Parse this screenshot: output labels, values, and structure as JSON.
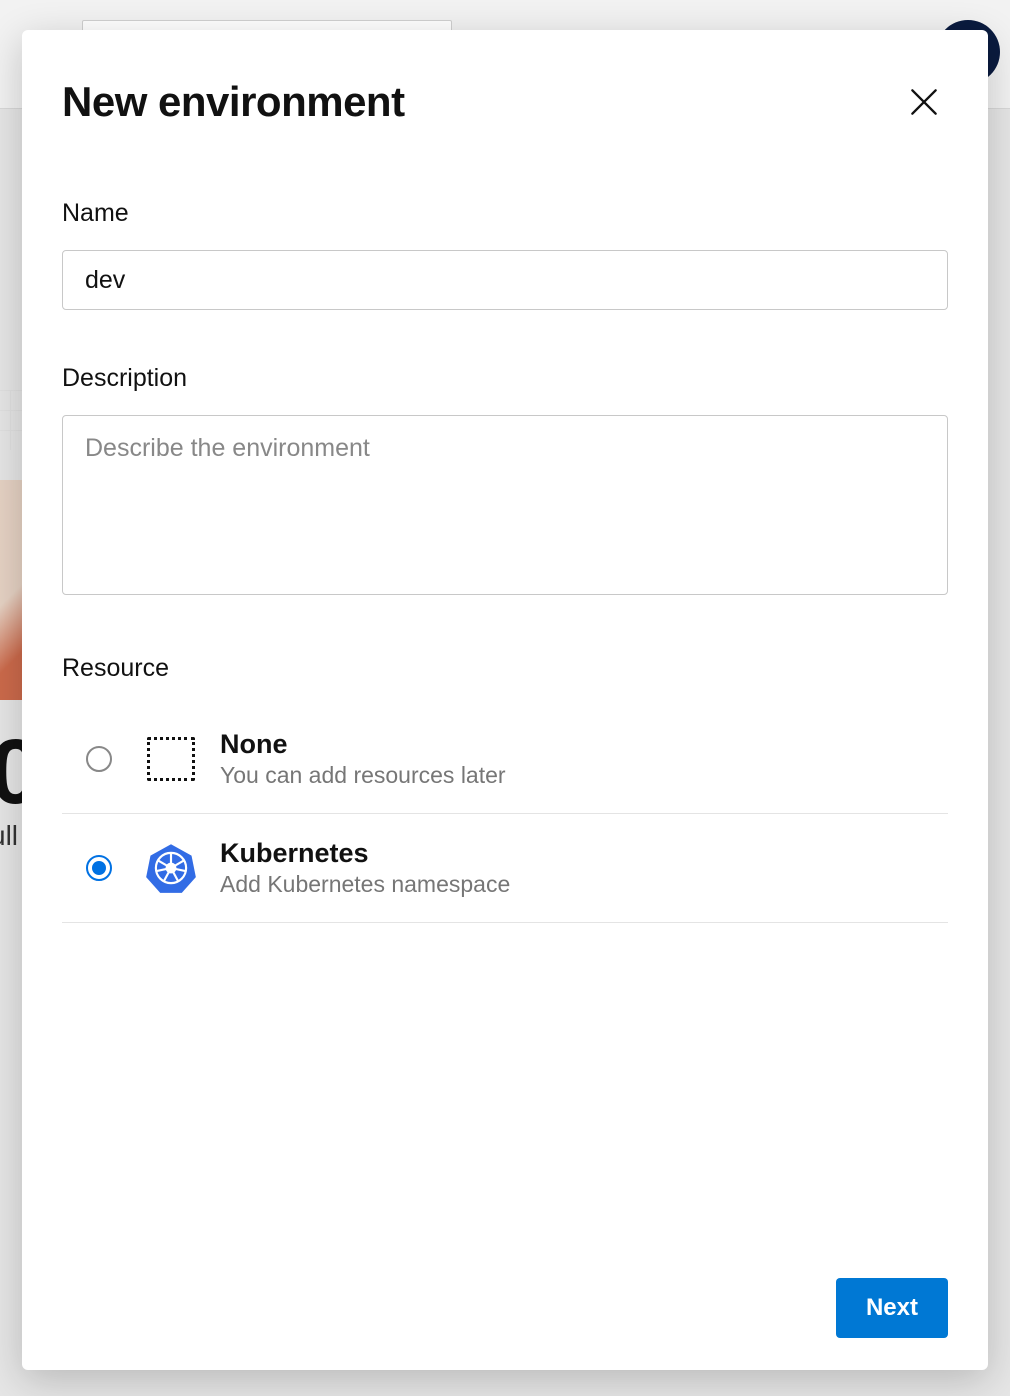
{
  "modal": {
    "title": "New environment",
    "name_label": "Name",
    "name_value": "dev",
    "description_label": "Description",
    "description_placeholder": "Describe the environment",
    "resource_label": "Resource",
    "resources": [
      {
        "id": "none",
        "title": "None",
        "subtitle": "You can add resources later",
        "selected": false
      },
      {
        "id": "kubernetes",
        "title": "Kubernetes",
        "subtitle": "Add Kubernetes namespace",
        "selected": true
      }
    ],
    "next_label": "Next"
  },
  "colors": {
    "primary": "#0078d4",
    "radio_selected": "#0071e3",
    "kubernetes_icon": "#326ce5"
  },
  "background": {
    "snippet1": "0",
    "snippet2": "ull"
  }
}
